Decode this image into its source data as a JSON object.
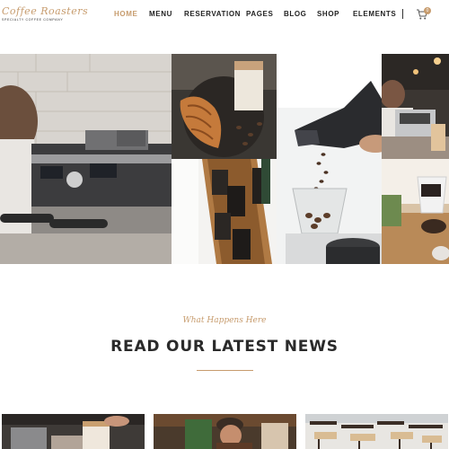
{
  "brand": {
    "logo_script": "Coffee Roasters",
    "logo_tagline": "SPECIALTY COFFEE COMPANY"
  },
  "nav": {
    "items": [
      {
        "label": "HOME",
        "active": true
      },
      {
        "label": "MENU",
        "active": false
      },
      {
        "label": "RESERVATION",
        "active": false
      },
      {
        "label": "PAGES",
        "active": false
      },
      {
        "label": "BLOG",
        "active": false
      },
      {
        "label": "SHOP",
        "active": false
      },
      {
        "label": "ELEMENTS",
        "active": false
      }
    ],
    "cart_count": "0",
    "cart_icon": "shopping-cart-icon"
  },
  "gallery": {
    "images": [
      "espresso-machine-photo",
      "croissant-coffee-photo",
      "coffee-bags-photo",
      "coffee-bean-pour-photo",
      "barista-bar-photo",
      "coffee-grinder-photo"
    ]
  },
  "news": {
    "eyebrow": "What Happens Here",
    "title": "READ OUR LATEST NEWS"
  },
  "colors": {
    "accent": "#c79c6e",
    "heading": "#2a2a2a",
    "nav_text": "#222222"
  }
}
